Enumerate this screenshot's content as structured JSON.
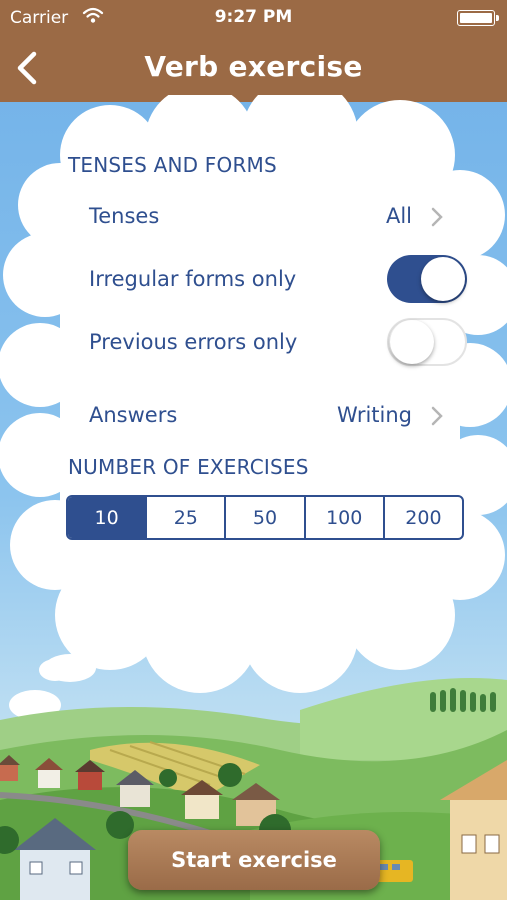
{
  "status_bar": {
    "carrier": "Carrier",
    "time": "9:27 PM"
  },
  "nav": {
    "title": "Verb exercise",
    "back_icon": "chevron-left-icon"
  },
  "tenses_section": {
    "header": "TENSES AND FORMS",
    "tenses_label": "Tenses",
    "tenses_value": "All",
    "irregular_label": "Irregular forms only",
    "irregular_on": true,
    "errors_label": "Previous errors only",
    "errors_on": false,
    "answers_label": "Answers",
    "answers_value": "Writing"
  },
  "exercises_section": {
    "header": "NUMBER OF EXERCISES",
    "options": [
      "10",
      "25",
      "50",
      "100",
      "200"
    ],
    "selected": "10"
  },
  "start_button": "Start exercise",
  "colors": {
    "brand_brown": "#9b6a45",
    "accent_blue": "#2f4f8f"
  }
}
